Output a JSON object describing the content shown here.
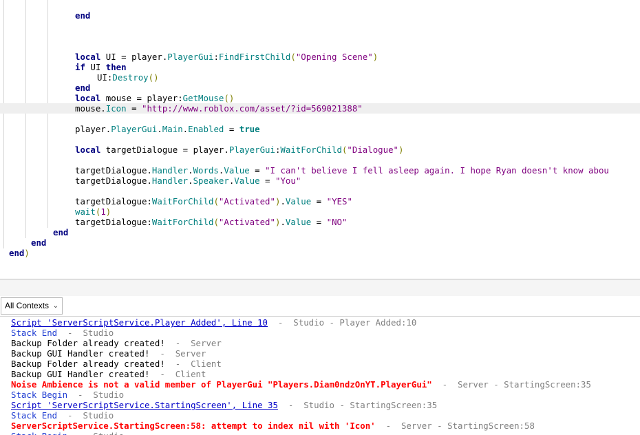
{
  "editor": {
    "lines": [
      {
        "indent": 13,
        "tokens": [
          [
            "kw",
            "end"
          ]
        ]
      },
      {
        "indent": 0,
        "tokens": []
      },
      {
        "indent": 0,
        "tokens": []
      },
      {
        "indent": 0,
        "tokens": []
      },
      {
        "indent": 13,
        "tokens": [
          [
            "kw",
            "local"
          ],
          [
            "tx",
            " UI = player."
          ],
          [
            "pr",
            "PlayerGui"
          ],
          [
            "tx",
            ":"
          ],
          [
            "fn",
            "FindFirstChild"
          ],
          [
            "pu",
            "("
          ],
          [
            "st",
            "\"Opening Scene\""
          ],
          [
            "pu",
            ")"
          ]
        ]
      },
      {
        "indent": 13,
        "tokens": [
          [
            "kw",
            "if"
          ],
          [
            "tx",
            " UI "
          ],
          [
            "kw",
            "then"
          ]
        ]
      },
      {
        "indent": 17,
        "tokens": [
          [
            "tx",
            "UI:"
          ],
          [
            "fn",
            "Destroy"
          ],
          [
            "pu",
            "()"
          ]
        ]
      },
      {
        "indent": 13,
        "tokens": [
          [
            "kw",
            "end"
          ]
        ]
      },
      {
        "indent": 13,
        "tokens": [
          [
            "kw",
            "local"
          ],
          [
            "tx",
            " mouse = player:"
          ],
          [
            "fn",
            "GetMouse"
          ],
          [
            "pu",
            "()"
          ]
        ]
      },
      {
        "indent": 13,
        "current": true,
        "tokens": [
          [
            "tx",
            "mouse."
          ],
          [
            "pr",
            "Icon"
          ],
          [
            "tx",
            " = "
          ],
          [
            "st",
            "\"http://www.roblox.com/asset/?id=569021388\""
          ]
        ]
      },
      {
        "indent": 0,
        "tokens": []
      },
      {
        "indent": 13,
        "tokens": [
          [
            "tx",
            "player."
          ],
          [
            "pr",
            "PlayerGui"
          ],
          [
            "tx",
            "."
          ],
          [
            "pr",
            "Main"
          ],
          [
            "tx",
            "."
          ],
          [
            "pr",
            "Enabled"
          ],
          [
            "tx",
            " = "
          ],
          [
            "bool",
            "true"
          ]
        ]
      },
      {
        "indent": 0,
        "tokens": []
      },
      {
        "indent": 13,
        "tokens": [
          [
            "kw",
            "local"
          ],
          [
            "tx",
            " targetDialogue = player."
          ],
          [
            "pr",
            "PlayerGui"
          ],
          [
            "tx",
            ":"
          ],
          [
            "fn",
            "WaitForChild"
          ],
          [
            "pu",
            "("
          ],
          [
            "st",
            "\"Dialogue\""
          ],
          [
            "pu",
            ")"
          ]
        ]
      },
      {
        "indent": 0,
        "tokens": []
      },
      {
        "indent": 13,
        "tokens": [
          [
            "tx",
            "targetDialogue."
          ],
          [
            "pr",
            "Handler"
          ],
          [
            "tx",
            "."
          ],
          [
            "pr",
            "Words"
          ],
          [
            "tx",
            "."
          ],
          [
            "pr",
            "Value"
          ],
          [
            "tx",
            " = "
          ],
          [
            "st",
            "\"I can't believe I fell asleep again. I hope Ryan doesn't know abou"
          ]
        ]
      },
      {
        "indent": 13,
        "tokens": [
          [
            "tx",
            "targetDialogue."
          ],
          [
            "pr",
            "Handler"
          ],
          [
            "tx",
            "."
          ],
          [
            "pr",
            "Speaker"
          ],
          [
            "tx",
            "."
          ],
          [
            "pr",
            "Value"
          ],
          [
            "tx",
            " = "
          ],
          [
            "st",
            "\"You\""
          ]
        ]
      },
      {
        "indent": 0,
        "tokens": []
      },
      {
        "indent": 13,
        "tokens": [
          [
            "tx",
            "targetDialogue:"
          ],
          [
            "fn",
            "WaitForChild"
          ],
          [
            "pu",
            "("
          ],
          [
            "st",
            "\"Activated\""
          ],
          [
            "pu",
            ")"
          ],
          [
            "tx",
            "."
          ],
          [
            "pr",
            "Value"
          ],
          [
            "tx",
            " = "
          ],
          [
            "st",
            "\"YES\""
          ]
        ]
      },
      {
        "indent": 13,
        "tokens": [
          [
            "fn",
            "wait"
          ],
          [
            "pu",
            "("
          ],
          [
            "st",
            "1"
          ],
          [
            "pu",
            ")"
          ]
        ]
      },
      {
        "indent": 13,
        "tokens": [
          [
            "tx",
            "targetDialogue:"
          ],
          [
            "fn",
            "WaitForChild"
          ],
          [
            "pu",
            "("
          ],
          [
            "st",
            "\"Activated\""
          ],
          [
            "pu",
            ")"
          ],
          [
            "tx",
            "."
          ],
          [
            "pr",
            "Value"
          ],
          [
            "tx",
            " = "
          ],
          [
            "st",
            "\"NO\""
          ]
        ]
      },
      {
        "indent": 9,
        "tokens": [
          [
            "kw",
            "end"
          ]
        ]
      },
      {
        "indent": 5,
        "tokens": [
          [
            "kw",
            "end"
          ]
        ]
      },
      {
        "indent": 1,
        "tokens": [
          [
            "kw",
            "end"
          ],
          [
            "pu",
            ")"
          ]
        ]
      }
    ]
  },
  "output_toolbar": {
    "context_filter": "All Contexts"
  },
  "output": {
    "lines": [
      {
        "spans": [
          [
            "o-link",
            "Script 'ServerScriptService.Player Added', Line 10"
          ],
          [
            "o-meta",
            "  -  Studio - Player Added:10"
          ]
        ]
      },
      {
        "spans": [
          [
            "o-blue",
            "Stack End"
          ],
          [
            "o-meta",
            "  -  Studio"
          ]
        ]
      },
      {
        "spans": [
          [
            "o-norm",
            "Backup Folder already created!"
          ],
          [
            "o-meta",
            "  -  Server"
          ]
        ]
      },
      {
        "spans": [
          [
            "o-norm",
            "Backup GUI Handler created!"
          ],
          [
            "o-meta",
            "  -  Server"
          ]
        ]
      },
      {
        "spans": [
          [
            "o-norm",
            "Backup Folder already created!"
          ],
          [
            "o-meta",
            "  -  Client"
          ]
        ]
      },
      {
        "spans": [
          [
            "o-norm",
            "Backup GUI Handler created!"
          ],
          [
            "o-meta",
            "  -  Client"
          ]
        ]
      },
      {
        "spans": [
          [
            "o-err",
            "Noise Ambience is not a valid member of PlayerGui \"Players.Diam0ndzOnYT.PlayerGui\""
          ],
          [
            "o-meta",
            "  -  Server - StartingScreen:35"
          ]
        ]
      },
      {
        "spans": [
          [
            "o-blue",
            "Stack Begin"
          ],
          [
            "o-meta",
            "  -  Studio"
          ]
        ]
      },
      {
        "spans": [
          [
            "o-link",
            "Script 'ServerScriptService.StartingScreen', Line 35"
          ],
          [
            "o-meta",
            "  -  Studio - StartingScreen:35"
          ]
        ]
      },
      {
        "spans": [
          [
            "o-blue",
            "Stack End"
          ],
          [
            "o-meta",
            "  -  Studio"
          ]
        ]
      },
      {
        "spans": [
          [
            "o-err",
            "ServerScriptService.StartingScreen:58: attempt to index nil with 'Icon'"
          ],
          [
            "o-meta",
            "  -  Server - StartingScreen:58"
          ]
        ]
      },
      {
        "spans": [
          [
            "o-blue",
            "Stack Begin"
          ],
          [
            "o-meta",
            "  -  Studio"
          ]
        ]
      }
    ]
  }
}
